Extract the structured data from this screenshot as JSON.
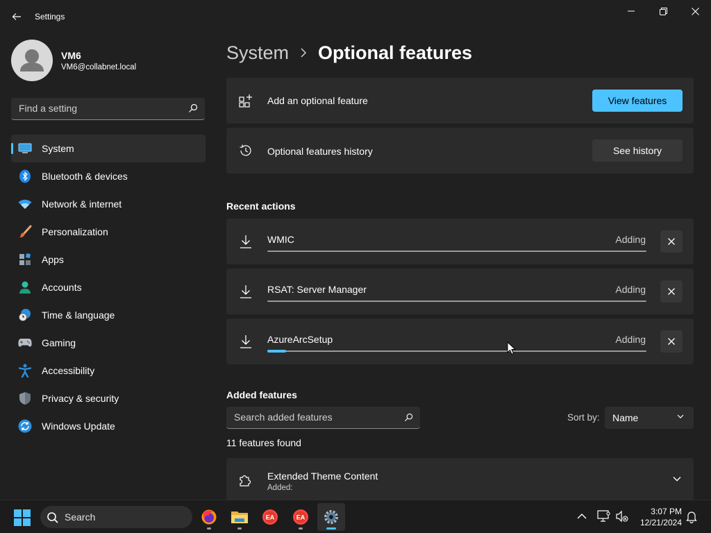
{
  "window": {
    "title": "Settings"
  },
  "profile": {
    "name": "VM6",
    "email": "VM6@collabnet.local"
  },
  "search": {
    "placeholder": "Find a setting"
  },
  "nav": {
    "items": [
      {
        "label": "System",
        "icon": "system-icon",
        "selected": true
      },
      {
        "label": "Bluetooth & devices",
        "icon": "bluetooth-icon"
      },
      {
        "label": "Network & internet",
        "icon": "wifi-icon"
      },
      {
        "label": "Personalization",
        "icon": "brush-icon"
      },
      {
        "label": "Apps",
        "icon": "apps-icon"
      },
      {
        "label": "Accounts",
        "icon": "accounts-icon"
      },
      {
        "label": "Time & language",
        "icon": "time-language-icon"
      },
      {
        "label": "Gaming",
        "icon": "gamepad-icon"
      },
      {
        "label": "Accessibility",
        "icon": "accessibility-icon"
      },
      {
        "label": "Privacy & security",
        "icon": "shield-icon"
      },
      {
        "label": "Windows Update",
        "icon": "update-icon"
      }
    ]
  },
  "breadcrumb": {
    "parent": "System",
    "current": "Optional features"
  },
  "add_feature": {
    "label": "Add an optional feature",
    "button": "View features"
  },
  "history": {
    "label": "Optional features history",
    "button": "See history"
  },
  "recent": {
    "title": "Recent actions",
    "items": [
      {
        "name": "WMIC",
        "status": "Adding",
        "progress": 0
      },
      {
        "name": "RSAT: Server Manager",
        "status": "Adding",
        "progress": 0
      },
      {
        "name": "AzureArcSetup",
        "status": "Adding",
        "progress": 0.05
      }
    ]
  },
  "added": {
    "title": "Added features",
    "search_placeholder": "Search added features",
    "sort_label": "Sort by:",
    "sort_value": "Name",
    "count_text": "11 features found",
    "items": [
      {
        "name": "Extended Theme Content",
        "sub": "Added:"
      }
    ]
  },
  "taskbar": {
    "search_label": "Search",
    "apps": [
      "firefox-icon",
      "file-explorer-icon",
      "ea-app-icon",
      "ea-app-icon",
      "settings-icon"
    ],
    "time": "3:07 PM",
    "date": "12/21/2024"
  },
  "colors": {
    "accent": "#4cc2ff",
    "background": "#202020",
    "card": "#2b2b2b"
  }
}
